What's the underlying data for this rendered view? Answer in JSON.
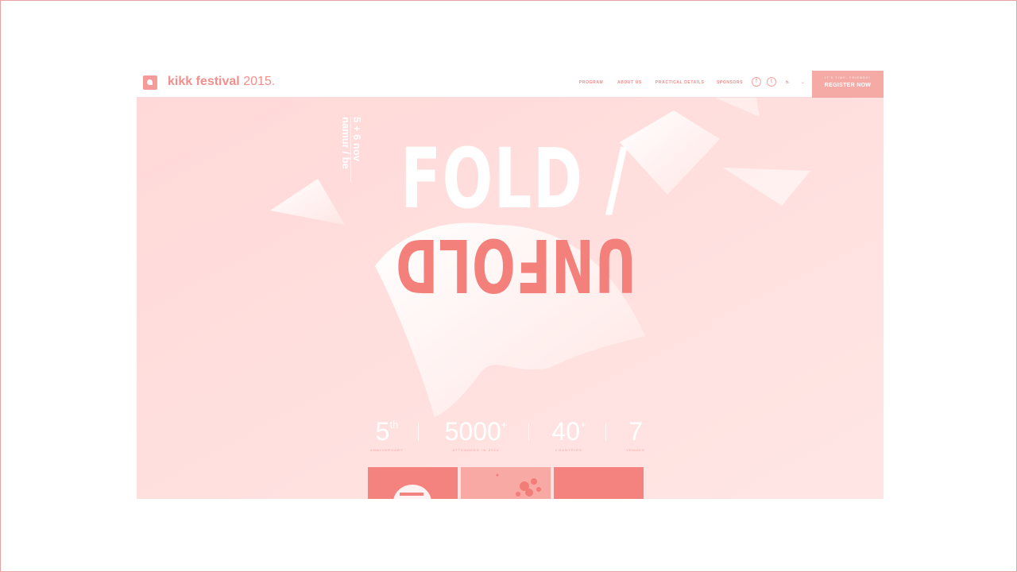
{
  "header": {
    "brand_bold": "kikk festival",
    "brand_year": "2015.",
    "nav": [
      "PROGRAM",
      "ABOUT US",
      "PRACTICAL DETAILS",
      "SPONSORS"
    ],
    "social": {
      "facebook_glyph": "f",
      "twitter_glyph": "t"
    },
    "language": "fr.",
    "register_small": "IT'S TIME, FRIENDS!",
    "register_label": "REGISTER NOW"
  },
  "hero": {
    "date_line1": "5 + 6 nov",
    "date_line2": "namur / be",
    "title_top": "FOLD /",
    "title_bottom": "UNFOLD"
  },
  "stats": [
    {
      "value": "5",
      "sup": "th",
      "caption": "ANNIVERSARY"
    },
    {
      "value": "5000",
      "sup": "+",
      "caption": "ATTENDEES IN 2014"
    },
    {
      "value": "40",
      "sup": "+",
      "caption": "COUNTRIES"
    },
    {
      "value": "7",
      "sup": "",
      "caption": "VENUES"
    }
  ],
  "colors": {
    "accent": "#f28f8d",
    "background": "#ffe0df",
    "register": "#f6aaa6"
  }
}
